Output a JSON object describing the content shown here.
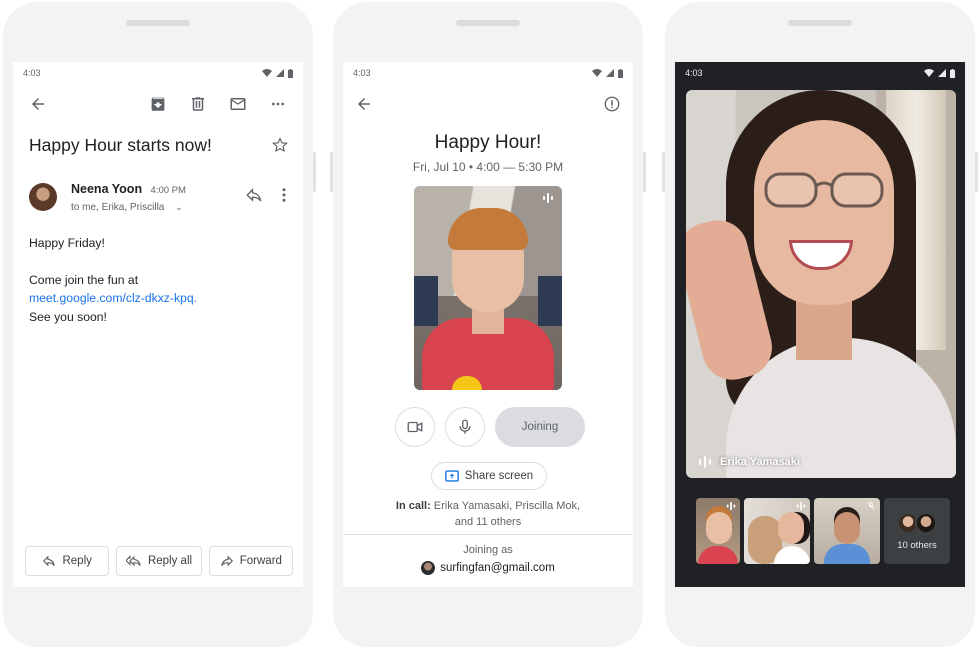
{
  "phone_gmail": {
    "status_time": "4:03",
    "subject": "Happy Hour starts now!",
    "sender_name": "Neena Yoon",
    "sender_time": "4:00 PM",
    "recipients": "to me, Erika, Priscilla",
    "body_greeting": "Happy Friday!",
    "body_line1": "Come join the fun at",
    "body_link": "meet.google.com/clz-dkxz-kpq.",
    "body_line2": "See you soon!",
    "reply_label": "Reply",
    "reply_all_label": "Reply all",
    "forward_label": "Forward"
  },
  "phone_meet_join": {
    "status_time": "4:03",
    "title": "Happy Hour!",
    "date_time": "Fri, Jul 10  •  4:00 — 5:30 PM",
    "joining_label": "Joining",
    "share_screen_label": "Share screen",
    "in_call_label": "In call:",
    "in_call_names": "Erika Yamasaki, Priscilla Mok,",
    "in_call_more": "and 11 others",
    "joining_as_label": "Joining as",
    "account": "surfingfan@gmail.com"
  },
  "phone_meet_call": {
    "status_time": "4:03",
    "speaker_name": "Erika Yamasaki",
    "others_count_label": "10 others"
  },
  "colors": {
    "link": "#1a73e8",
    "call_background": "#202124",
    "joining_button": "#dadce0"
  }
}
